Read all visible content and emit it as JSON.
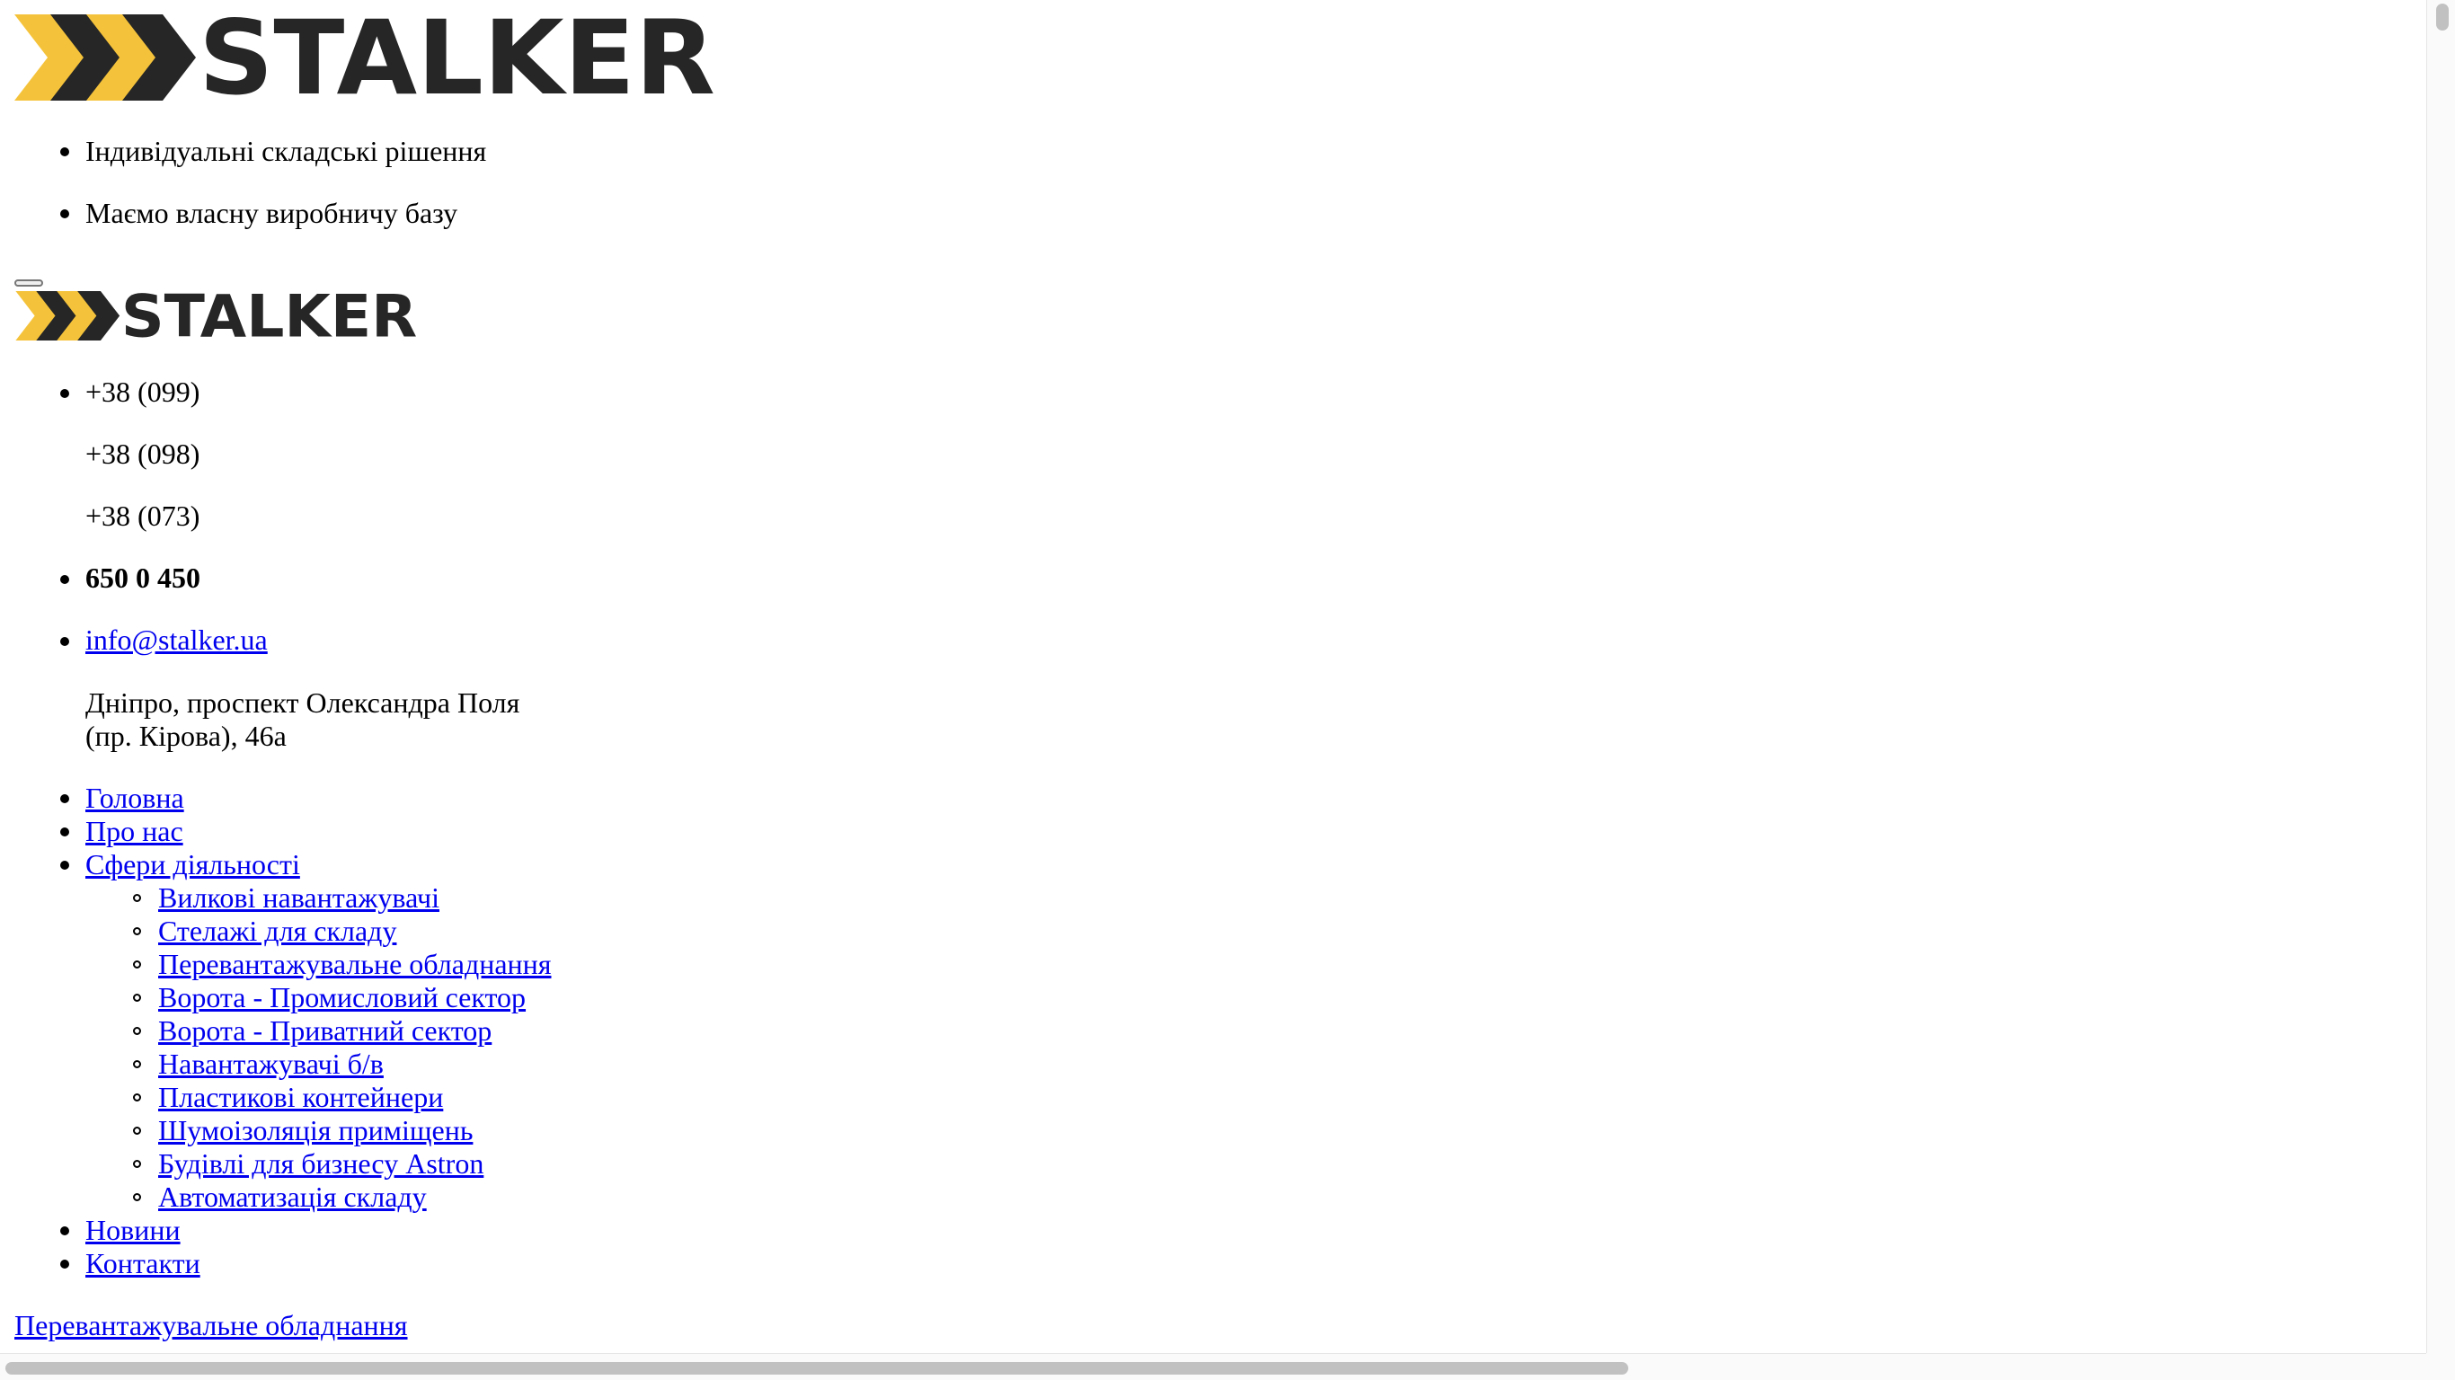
{
  "brand": {
    "name": "STALKER",
    "colors": {
      "chevron": "#f5c33b",
      "chevron_dark": "#262626",
      "text": "#262626"
    }
  },
  "features": [
    "Індивідуальні складські рішення",
    "Маємо власну виробничу базу"
  ],
  "contacts": {
    "phone_codes": [
      "+38 (099)",
      "+38 (098)",
      "+38 (073)"
    ],
    "phone_number": "650 0 450",
    "email": "info@stalker.ua",
    "address_line1": "Дніпро, проспект Олександра Поля",
    "address_line2": "(пр. Кірова), 46а"
  },
  "nav": {
    "items": [
      "Головна",
      "Про нас",
      "Сфери діяльності",
      "Новини",
      "Контакти"
    ],
    "submenu": [
      "Вилкові навантажувачі",
      "Стелажі для складу",
      "Перевантажувальне обладнання",
      "Ворота - Промисловий сектор",
      "Ворота - Приватний сектор",
      "Навантажувачі б/в",
      "Пластикові контейнери",
      "Шумоізоляція приміщень",
      "Будівлі для бизнесу Astron",
      "Автоматизація складу"
    ]
  },
  "breadcrumb": {
    "current": "Перевантажувальне обладнання"
  }
}
